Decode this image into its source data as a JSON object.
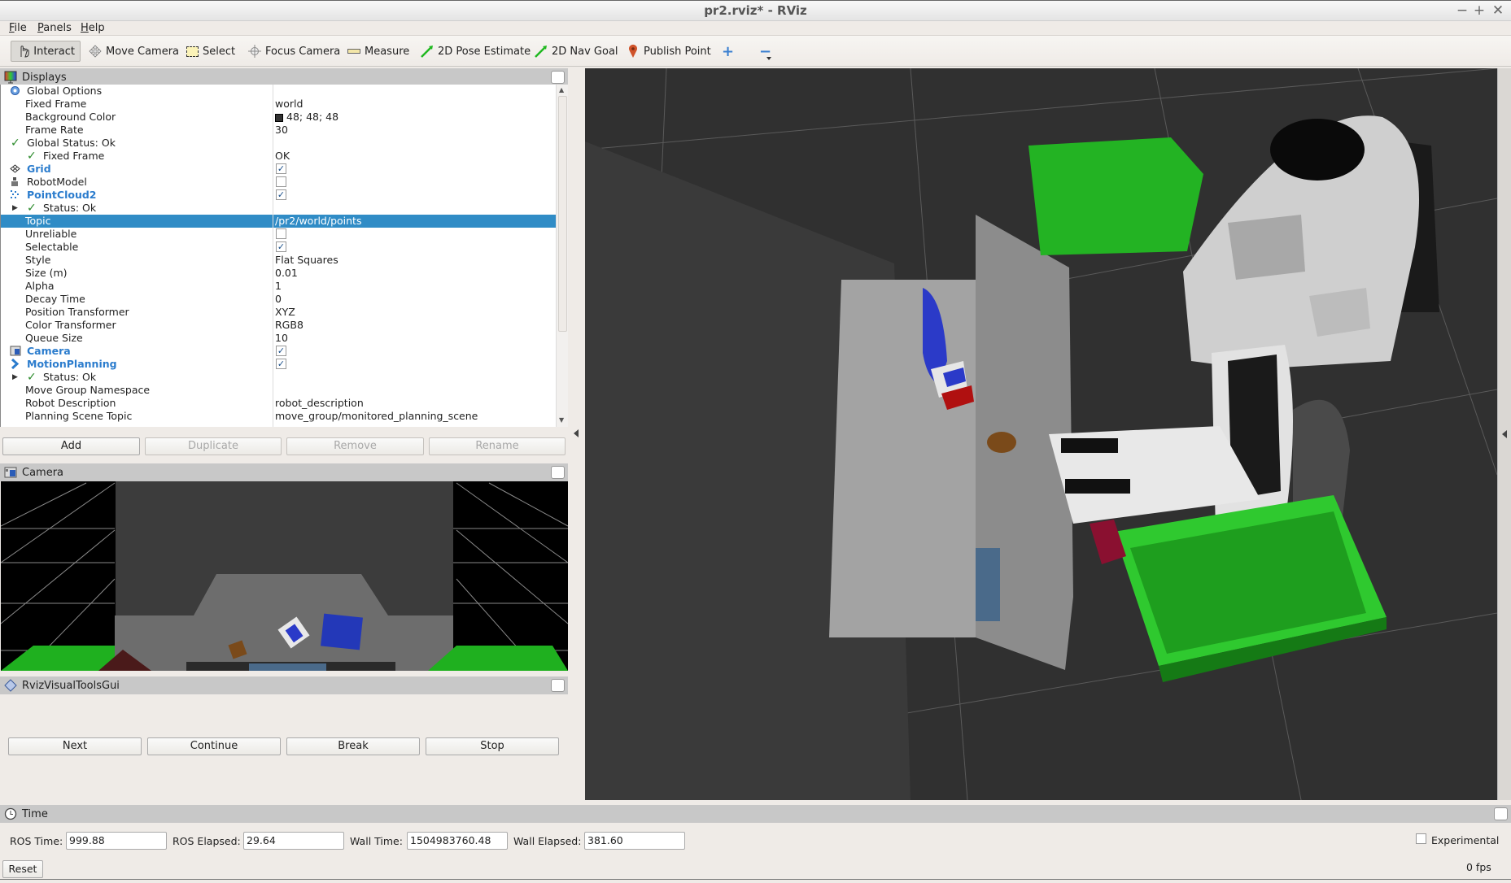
{
  "window": {
    "title": "pr2.rviz* - RViz",
    "controls": [
      "−",
      "+",
      "✕"
    ]
  },
  "menubar": [
    {
      "label": "File",
      "accel": "F",
      "rest": "ile"
    },
    {
      "label": "Panels",
      "accel": "P",
      "rest": "anels"
    },
    {
      "label": "Help",
      "accel": "H",
      "rest": "elp"
    }
  ],
  "toolbar": {
    "tools": [
      {
        "label": "Interact",
        "icon": "hand-pointer-icon",
        "active": true
      },
      {
        "label": "Move Camera",
        "icon": "move-camera-icon"
      },
      {
        "label": "Select",
        "icon": "select-box-icon"
      },
      {
        "label": "Focus Camera",
        "icon": "focus-camera-icon"
      },
      {
        "label": "Measure",
        "icon": "ruler-icon"
      },
      {
        "label": "2D Pose Estimate",
        "icon": "green-arrow-icon"
      },
      {
        "label": "2D Nav Goal",
        "icon": "green-arrow-icon"
      },
      {
        "label": "Publish Point",
        "icon": "map-pin-icon"
      }
    ],
    "add_tool": "+",
    "remove_tool": "−"
  },
  "displays": {
    "title": "Displays",
    "rows": [
      {
        "name": "Global Options",
        "value": "",
        "indent": 1,
        "icon": "gear"
      },
      {
        "name": "Fixed Frame",
        "value": "world",
        "indent": 2
      },
      {
        "name": "Background Color",
        "value": "48; 48; 48",
        "indent": 2,
        "swatch": "#303030"
      },
      {
        "name": "Frame Rate",
        "value": "30",
        "indent": 2
      },
      {
        "name": "Global Status: Ok",
        "value": "",
        "indent": 1,
        "check": true
      },
      {
        "name": "Fixed Frame",
        "value": "OK",
        "indent": 2,
        "check": true
      },
      {
        "name": "Grid",
        "value": "",
        "indent": 1,
        "bold": true,
        "icon": "grid",
        "checkbox": true
      },
      {
        "name": "RobotModel",
        "value": "",
        "indent": 1,
        "icon": "robot",
        "checkbox": false
      },
      {
        "name": "PointCloud2",
        "value": "",
        "indent": 1,
        "bold": true,
        "icon": "pointcloud",
        "checkbox": true
      },
      {
        "name": "Status: Ok",
        "value": "",
        "indent": 2,
        "check": true,
        "expander": true
      },
      {
        "name": "Topic",
        "value": "/pr2/world/points",
        "indent": 2,
        "selected": true
      },
      {
        "name": "Unreliable",
        "value": "",
        "indent": 2,
        "checkbox": false
      },
      {
        "name": "Selectable",
        "value": "",
        "indent": 2,
        "checkbox": true
      },
      {
        "name": "Style",
        "value": "Flat Squares",
        "indent": 2
      },
      {
        "name": "Size (m)",
        "value": "0.01",
        "indent": 2
      },
      {
        "name": "Alpha",
        "value": "1",
        "indent": 2
      },
      {
        "name": "Decay Time",
        "value": "0",
        "indent": 2
      },
      {
        "name": "Position Transformer",
        "value": "XYZ",
        "indent": 2
      },
      {
        "name": "Color Transformer",
        "value": "RGB8",
        "indent": 2
      },
      {
        "name": "Queue Size",
        "value": "10",
        "indent": 2
      },
      {
        "name": "Camera",
        "value": "",
        "indent": 1,
        "bold": true,
        "icon": "camera",
        "checkbox": true
      },
      {
        "name": "MotionPlanning",
        "value": "",
        "indent": 1,
        "bold": true,
        "icon": "motion",
        "checkbox": true
      },
      {
        "name": "Status: Ok",
        "value": "",
        "indent": 2,
        "check": true,
        "expander": true
      },
      {
        "name": "Move Group Namespace",
        "value": "",
        "indent": 2
      },
      {
        "name": "Robot Description",
        "value": "robot_description",
        "indent": 2
      },
      {
        "name": "Planning Scene Topic",
        "value": "move_group/monitored_planning_scene",
        "indent": 2
      }
    ],
    "buttons": {
      "add": "Add",
      "duplicate": "Duplicate",
      "remove": "Remove",
      "rename": "Rename"
    }
  },
  "camera_panel": {
    "title": "Camera"
  },
  "visual_tools": {
    "title": "RvizVisualToolsGui",
    "buttons": {
      "next": "Next",
      "continue": "Continue",
      "break": "Break",
      "stop": "Stop"
    }
  },
  "time_panel": {
    "title": "Time",
    "ros_time_label": "ROS Time:",
    "ros_time": "999.88",
    "ros_elapsed_label": "ROS Elapsed:",
    "ros_elapsed": "29.64",
    "wall_time_label": "Wall Time:",
    "wall_time": "1504983760.48",
    "wall_elapsed_label": "Wall Elapsed:",
    "wall_elapsed": "381.60",
    "experimental_label": "Experimental",
    "experimental_checked": false,
    "reset_label": "Reset",
    "fps": "0 fps"
  },
  "colors": {
    "selection": "#308cc6",
    "display_name": "#2b7ccd",
    "scene_bg": "#303030",
    "bin_green": "#2fc92f"
  }
}
